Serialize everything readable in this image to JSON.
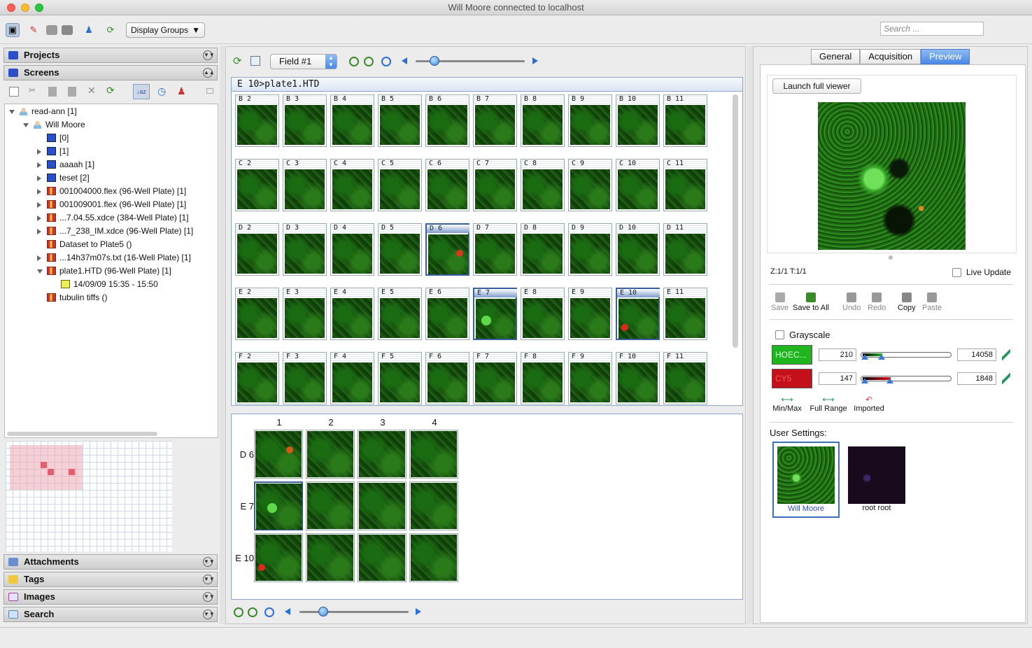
{
  "window": {
    "title": "Will Moore connected to localhost"
  },
  "toolbar": {
    "display_groups": "Display Groups",
    "search_placeholder": "Search ..."
  },
  "left_panel": {
    "projects": "Projects",
    "screens": "Screens",
    "attachments": "Attachments",
    "tags": "Tags",
    "images": "Images",
    "search": "Search",
    "tree": [
      {
        "label": "read-ann [1]",
        "icon": "group-icon",
        "level": 0,
        "expander": "down"
      },
      {
        "label": "Will Moore",
        "icon": "user-icon",
        "level": 1,
        "expander": "down"
      },
      {
        "label": "[0]",
        "icon": "screen-icon",
        "level": 2,
        "expander": "none"
      },
      {
        "label": "[1]",
        "icon": "screen-icon",
        "level": 2,
        "expander": "right"
      },
      {
        "label": "aaaah [1]",
        "icon": "screen-icon",
        "level": 2,
        "expander": "right"
      },
      {
        "label": "teset [2]",
        "icon": "screen-icon",
        "level": 2,
        "expander": "right"
      },
      {
        "label": "001004000.flex (96-Well Plate) [1]",
        "icon": "plate-icon",
        "level": 2,
        "expander": "right"
      },
      {
        "label": "001009001.flex (96-Well Plate) [1]",
        "icon": "plate-icon",
        "level": 2,
        "expander": "right"
      },
      {
        "label": "...7.04.55.xdce (384-Well Plate) [1]",
        "icon": "plate-icon",
        "level": 2,
        "expander": "right"
      },
      {
        "label": "...7_238_IM.xdce (96-Well Plate) [1]",
        "icon": "plate-icon",
        "level": 2,
        "expander": "right"
      },
      {
        "label": "Dataset to Plate5 ()",
        "icon": "plate-icon",
        "level": 2,
        "expander": "none"
      },
      {
        "label": "...14h37m07s.txt (16-Well Plate) [1]",
        "icon": "plate-icon",
        "level": 2,
        "expander": "right"
      },
      {
        "label": "plate1.HTD (96-Well Plate) [1]",
        "icon": "plate-icon",
        "level": 2,
        "expander": "down"
      },
      {
        "label": "14/09/09 15:35 - 15:50",
        "icon": "run-icon",
        "level": 3,
        "expander": "none"
      },
      {
        "label": "tubulin tiffs ()",
        "icon": "plate-icon",
        "level": 2,
        "expander": "none"
      }
    ]
  },
  "center": {
    "field_select": "Field #1",
    "path": "E 10>plate1.HTD",
    "wells": [
      [
        "B 2",
        "B 3",
        "B 4",
        "B 5",
        "B 6",
        "B 7",
        "B 8",
        "B 9",
        "B 10",
        "B 11"
      ],
      [
        "C 2",
        "C 3",
        "C 4",
        "C 5",
        "C 6",
        "C 7",
        "C 8",
        "C 9",
        "C 10",
        "C 11"
      ],
      [
        "D 2",
        "D 3",
        "D 4",
        "D 5",
        "D 6",
        "D 7",
        "D 8",
        "D 9",
        "D 10",
        "D 11"
      ],
      [
        "E 2",
        "E 3",
        "E 4",
        "E 5",
        "E 6",
        "E 7",
        "E 8",
        "E 9",
        "E 10",
        "E 11"
      ],
      [
        "F 2",
        "F 3",
        "F 4",
        "F 5",
        "F 6",
        "F 7",
        "F 8",
        "F 9",
        "F 10",
        "F 11"
      ]
    ],
    "selected_wells": [
      "D 6",
      "E 7",
      "E 10"
    ],
    "field_cols": [
      "1",
      "2",
      "3",
      "4"
    ],
    "field_rows": [
      "D 6",
      "E 7",
      "E 10"
    ]
  },
  "right_panel": {
    "tabs": [
      "General",
      "Acquisition",
      "Preview"
    ],
    "active_tab": "Preview",
    "launch": "Launch full viewer",
    "zt": "Z:1/1 T:1/1",
    "live_update": "Live Update",
    "actions": [
      "Save",
      "Save to All",
      "Undo",
      "Redo",
      "Copy",
      "Paste"
    ],
    "grayscale": "Grayscale",
    "channels": [
      {
        "name": "HOEC...",
        "min": "210",
        "max": "14058",
        "color": "#1fb51f"
      },
      {
        "name": "CY5",
        "min": "147",
        "max": "1848",
        "color": "#c4101a"
      }
    ],
    "range_buttons": [
      "Min/Max",
      "Full Range",
      "Imported"
    ],
    "user_settings_label": "User Settings:",
    "users": [
      "Will Moore",
      "root root"
    ]
  }
}
